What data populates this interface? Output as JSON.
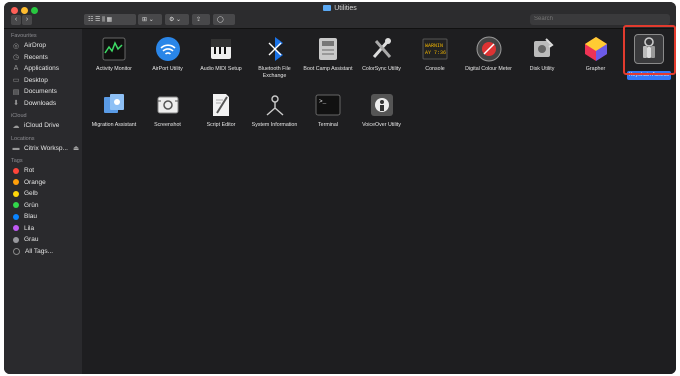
{
  "window": {
    "title": "Utilities"
  },
  "toolbar": {
    "back": "‹",
    "forward": "›",
    "view_group": "☷ ☰ ⫼ ▦",
    "arrange": "⊞ ⌄",
    "action": "⚙ ⌄",
    "share": "⇪",
    "tag": "◯"
  },
  "search": {
    "placeholder": "Search"
  },
  "sidebar": {
    "favourites_heading": "Favourites",
    "favourites": [
      {
        "label": "AirDrop",
        "icon": "airdrop-icon",
        "glyph": "◎"
      },
      {
        "label": "Recents",
        "icon": "clock-icon",
        "glyph": "◷"
      },
      {
        "label": "Applications",
        "icon": "applications-icon",
        "glyph": "A"
      },
      {
        "label": "Desktop",
        "icon": "desktop-icon",
        "glyph": "▭"
      },
      {
        "label": "Documents",
        "icon": "document-icon",
        "glyph": "▤"
      },
      {
        "label": "Downloads",
        "icon": "download-icon",
        "glyph": "⬇"
      }
    ],
    "icloud_heading": "iCloud",
    "icloud": [
      {
        "label": "iCloud Drive",
        "icon": "cloud-icon",
        "glyph": "☁"
      }
    ],
    "locations_heading": "Locations",
    "locations": [
      {
        "label": "Citrix Worksp...",
        "icon": "drive-icon",
        "glyph": "▬",
        "eject": "⏏"
      }
    ],
    "tags_heading": "Tags",
    "tags": [
      {
        "label": "Rot",
        "color": "#ff453a"
      },
      {
        "label": "Orange",
        "color": "#ff9f0a"
      },
      {
        "label": "Gelb",
        "color": "#ffd60a"
      },
      {
        "label": "Grün",
        "color": "#32d74b"
      },
      {
        "label": "Blau",
        "color": "#0a84ff"
      },
      {
        "label": "Lila",
        "color": "#bf5af2"
      },
      {
        "label": "Grau",
        "color": "#98989d"
      }
    ],
    "all_tags": "All Tags..."
  },
  "apps": [
    {
      "label": "Activity Monitor",
      "icon": "activity-monitor-icon"
    },
    {
      "label": "AirPort Utility",
      "icon": "airport-utility-icon"
    },
    {
      "label": "Audio MIDI Setup",
      "icon": "audio-midi-icon"
    },
    {
      "label": "Bluetooth File Exchange",
      "icon": "bluetooth-icon"
    },
    {
      "label": "Boot Camp Assistant",
      "icon": "boot-camp-icon"
    },
    {
      "label": "ColorSync Utility",
      "icon": "colorsync-icon"
    },
    {
      "label": "Console",
      "icon": "console-icon",
      "badge_text": "WARNIN\nAY 7:36"
    },
    {
      "label": "Digital Colour Meter",
      "icon": "colour-meter-icon"
    },
    {
      "label": "Disk Utility",
      "icon": "disk-utility-icon"
    },
    {
      "label": "Grapher",
      "icon": "grapher-icon"
    },
    {
      "label": "Keychain Access",
      "icon": "keychain-icon",
      "selected": true
    },
    {
      "label": "Migration Assistant",
      "icon": "migration-icon"
    },
    {
      "label": "Screenshot",
      "icon": "screenshot-icon"
    },
    {
      "label": "Script Editor",
      "icon": "script-editor-icon"
    },
    {
      "label": "System Information",
      "icon": "system-info-icon"
    },
    {
      "label": "Terminal",
      "icon": "terminal-icon",
      "badge_text": ">_"
    },
    {
      "label": "VoiceOver Utility",
      "icon": "voiceover-icon"
    }
  ],
  "colors": {
    "highlight_box": "#e23b2e",
    "selection": "#3478f6"
  }
}
